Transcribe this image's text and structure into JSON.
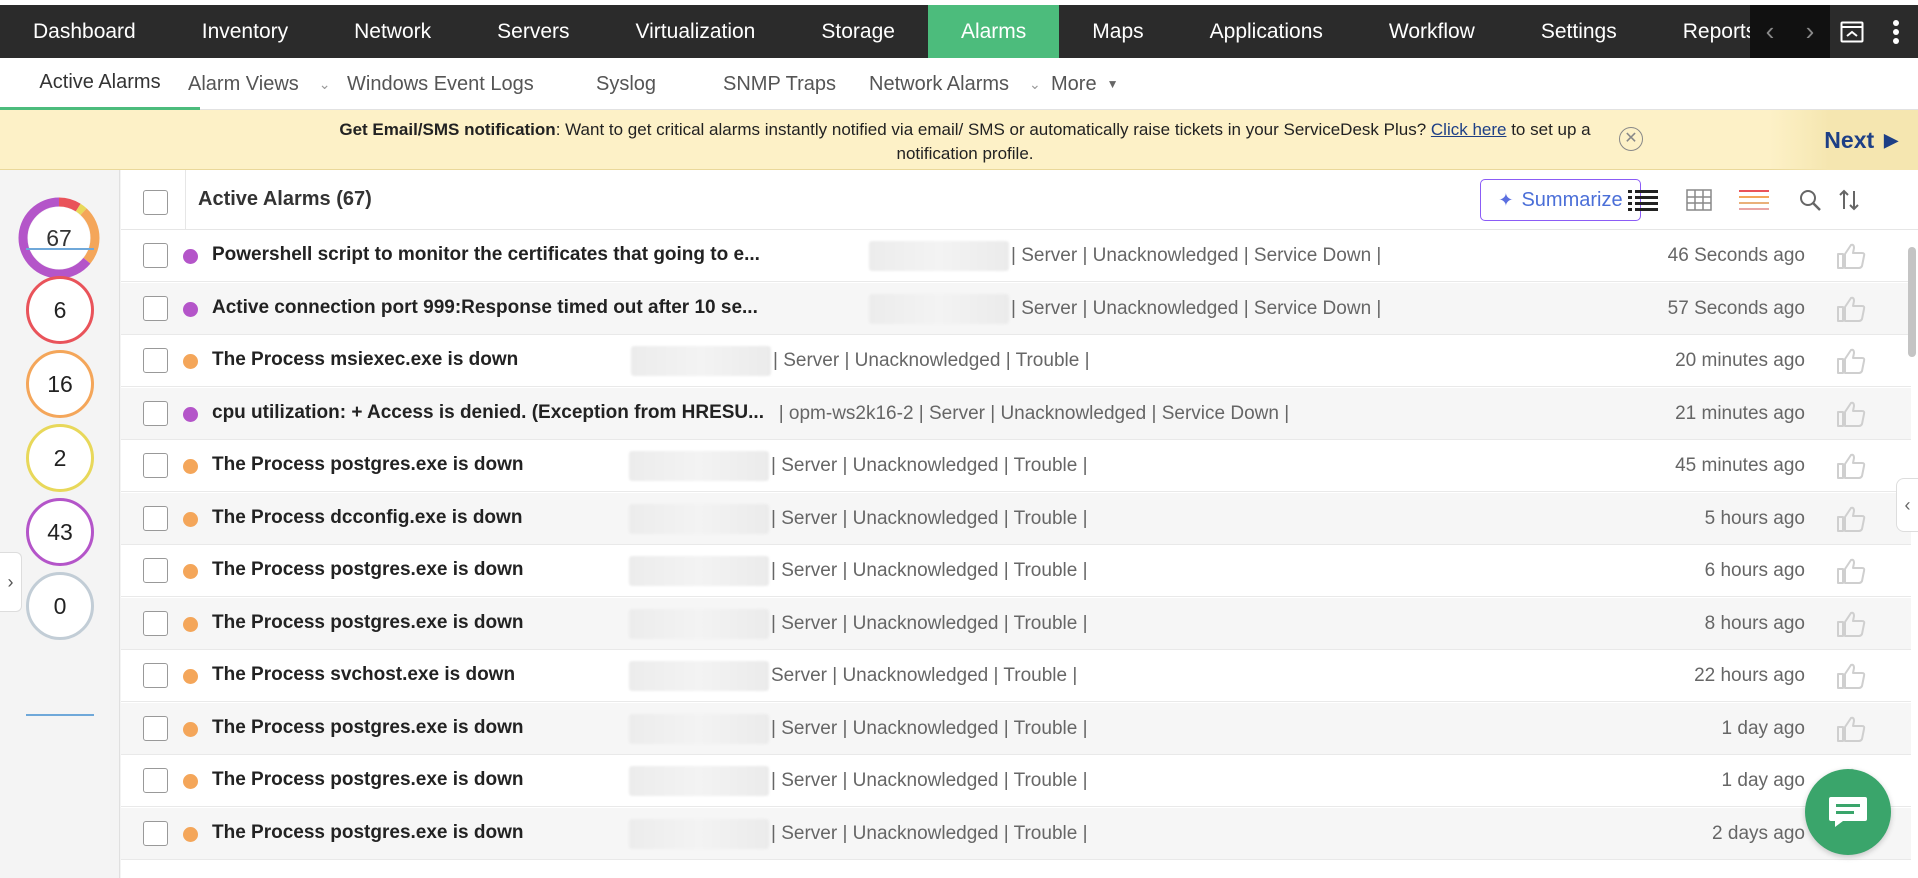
{
  "colors": {
    "accent_green": "#4cbc7c",
    "service_down": "#b455c9",
    "trouble": "#f4a65a",
    "critical": "#e9535a",
    "attention": "#e8d85a",
    "clear": "#c2cdd6",
    "nav_bg": "#2b2b2b",
    "banner_bg": "#fdf1c7"
  },
  "topnav": {
    "items": [
      "Dashboard",
      "Inventory",
      "Network",
      "Servers",
      "Virtualization",
      "Storage",
      "Alarms",
      "Maps",
      "Applications",
      "Workflow",
      "Settings",
      "Reports"
    ],
    "active": "Alarms",
    "controls": [
      "chevron-left-icon",
      "chevron-right-icon",
      "window-icon",
      "kebab-menu-icon"
    ]
  },
  "subnav": {
    "items": [
      {
        "label": "Active Alarms",
        "dropdown": false
      },
      {
        "label": "Alarm Views",
        "dropdown": true
      },
      {
        "label": "Windows Event Logs",
        "dropdown": false
      },
      {
        "label": "Syslog",
        "dropdown": false
      },
      {
        "label": "SNMP Traps",
        "dropdown": false
      },
      {
        "label": "Network Alarms",
        "dropdown": true
      },
      {
        "label": "More",
        "dropdown": true
      }
    ],
    "active": "Active Alarms"
  },
  "banner": {
    "bold": "Get Email/SMS notification",
    "text": ": Want to get critical alarms instantly notified via email/ SMS or automatically raise tickets in your ServiceDesk Plus? ",
    "link": "Click here",
    "tail": " to set up a notification profile.",
    "next_label": "Next"
  },
  "summary": {
    "total": "67",
    "counts": [
      {
        "severity": "critical",
        "value": "6"
      },
      {
        "severity": "trouble",
        "value": "16"
      },
      {
        "severity": "attention",
        "value": "2"
      },
      {
        "severity": "service_down",
        "value": "43"
      },
      {
        "severity": "clear",
        "value": "0"
      }
    ]
  },
  "list": {
    "title": "Active Alarms (67)",
    "summarize_label": "Summarize",
    "rows": [
      {
        "severity": "service_down",
        "message": "Powershell script to monitor the certificates that going to e...",
        "device": "",
        "meta": "| Server | Unacknowledged | Service Down |",
        "time": "46 Seconds ago"
      },
      {
        "severity": "service_down",
        "message": "Active connection port 999:Response timed out after 10 se...",
        "device": "",
        "meta": "| Server | Unacknowledged | Service Down |",
        "time": "57 Seconds ago"
      },
      {
        "severity": "trouble",
        "message": "The Process msiexec.exe is down",
        "device": "",
        "meta": "| Server | Unacknowledged | Trouble |",
        "time": "20 minutes ago"
      },
      {
        "severity": "service_down",
        "message": "cpu utilization: + Access is denied. (Exception from HRESU...",
        "device": "opm-ws2k16-2",
        "meta": "| Server | Unacknowledged | Service Down |",
        "time": "21 minutes ago"
      },
      {
        "severity": "trouble",
        "message": "The Process postgres.exe is down",
        "device": "",
        "meta": "| Server | Unacknowledged | Trouble |",
        "time": "45 minutes ago"
      },
      {
        "severity": "trouble",
        "message": "The Process dcconfig.exe is down",
        "device": "",
        "meta": "| Server | Unacknowledged | Trouble |",
        "time": "5 hours ago"
      },
      {
        "severity": "trouble",
        "message": "The Process postgres.exe is down",
        "device": "",
        "meta": "| Server | Unacknowledged | Trouble |",
        "time": "6 hours ago"
      },
      {
        "severity": "trouble",
        "message": "The Process postgres.exe is down",
        "device": "",
        "meta": "| Server | Unacknowledged | Trouble |",
        "time": "8 hours ago"
      },
      {
        "severity": "trouble",
        "message": "The Process svchost.exe is down",
        "device": "",
        "meta": "Server | Unacknowledged | Trouble |",
        "time": "22 hours ago"
      },
      {
        "severity": "trouble",
        "message": "The Process postgres.exe is down",
        "device": "",
        "meta": "| Server | Unacknowledged | Trouble |",
        "time": "1 day ago"
      },
      {
        "severity": "trouble",
        "message": "The Process postgres.exe is down",
        "device": "",
        "meta": "| Server | Unacknowledged | Trouble |",
        "time": "1 day ago"
      },
      {
        "severity": "trouble",
        "message": "The Process postgres.exe is down",
        "device": "",
        "meta": "| Server | Unacknowledged | Trouble |",
        "time": "2 days ago"
      }
    ]
  }
}
